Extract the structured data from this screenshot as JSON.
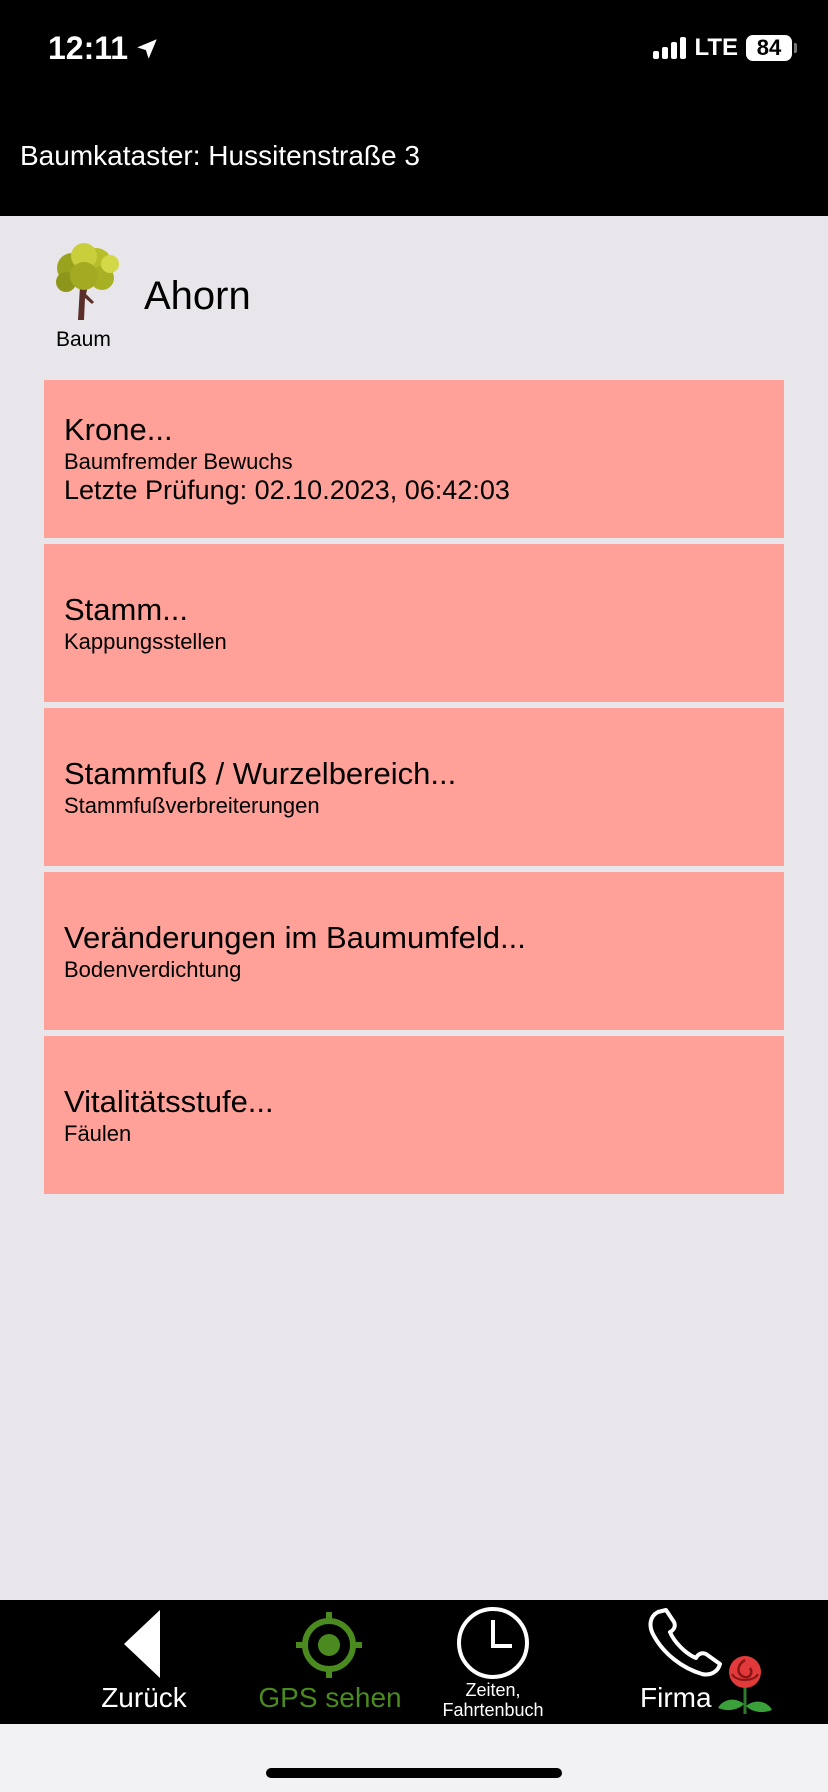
{
  "status_bar": {
    "time": "12:11",
    "network": "LTE",
    "battery": "84"
  },
  "app_title": "Baumkataster: Hussitenstraße 3",
  "tree": {
    "caption": "Baum",
    "name": "Ahorn"
  },
  "sections": [
    {
      "title": "Krone...",
      "detail": "Baumfremder Bewuchs",
      "last_check": "Letzte Prüfung: 02.10.2023, 06:42:03"
    },
    {
      "title": "Stamm...",
      "detail": "Kappungsstellen"
    },
    {
      "title": "Stammfuß / Wurzelbereich...",
      "detail": "Stammfußverbreiterungen"
    },
    {
      "title": "Veränderungen im Baumumfeld...",
      "detail": "Bodenverdichtung"
    },
    {
      "title": "Vitalitätsstufe...",
      "detail": "Fäulen"
    }
  ],
  "nav": {
    "back": "Zurück",
    "gps": "GPS sehen",
    "times_line1": "Zeiten,",
    "times_line2": "Fahrtenbuch",
    "company": "Firma"
  },
  "colors": {
    "section_bg": "#ffa198",
    "gps_green": "#4a8a1f",
    "bar_bg": "#000000"
  }
}
